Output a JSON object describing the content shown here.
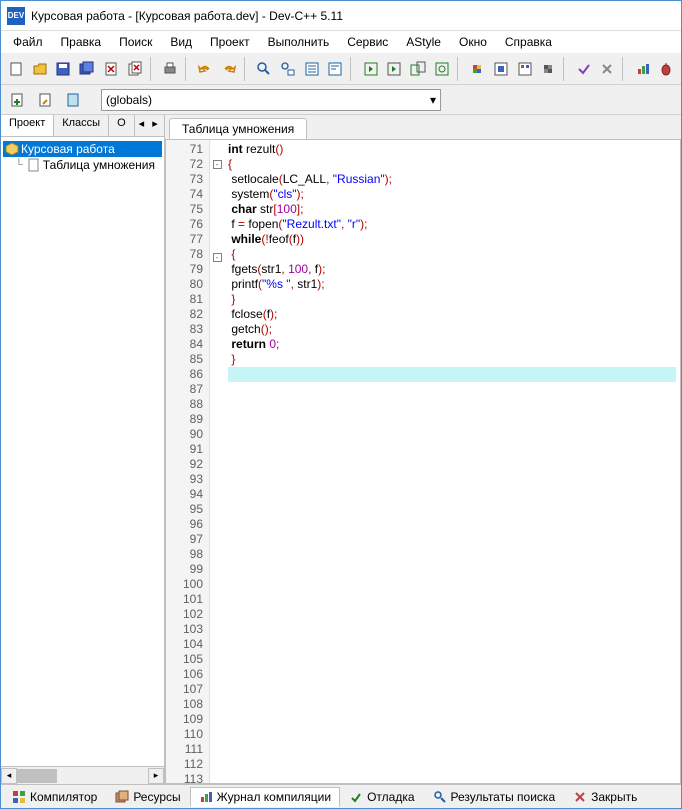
{
  "title": "Курсовая работа - [Курсовая работа.dev] - Dev-C++ 5.11",
  "menu": [
    "Файл",
    "Правка",
    "Поиск",
    "Вид",
    "Проект",
    "Выполнить",
    "Сервис",
    "AStyle",
    "Окно",
    "Справка"
  ],
  "globals": "(globals)",
  "left_tabs": {
    "project": "Проект",
    "classes": "Классы",
    "debug": "О"
  },
  "tree": {
    "root": "Курсовая работа",
    "child": "Таблица умножения"
  },
  "editor_tab": "Таблица умножения",
  "code_lines": [
    {
      "n": 71,
      "fold": "",
      "html": "<span class='kw'>int</span> <span class='fn'>rezult</span><span class='pun'>()</span>"
    },
    {
      "n": 72,
      "fold": "-",
      "html": "<span class='pun'>{</span>"
    },
    {
      "n": 73,
      "fold": "",
      "html": " <span class='fn'>setlocale</span><span class='pun'>(</span><span class='id'>LC_ALL</span><span class='pun'>,</span> <span class='str'>\"Russian\"</span><span class='pun'>);</span>"
    },
    {
      "n": 74,
      "fold": "",
      "html": " <span class='fn'>system</span><span class='pun'>(</span><span class='str'>\"cls\"</span><span class='pun'>);</span>"
    },
    {
      "n": 75,
      "fold": "",
      "html": " <span class='kw'>char</span> <span class='id'>str</span><span class='pun'>[</span><span class='num'>100</span><span class='pun'>];</span>"
    },
    {
      "n": 76,
      "fold": "",
      "html": " <span class='id'>f</span> <span class='pun'>=</span> <span class='fn'>fopen</span><span class='pun'>(</span><span class='str'>\"Rezult.txt\"</span><span class='pun'>,</span> <span class='str'>\"r\"</span><span class='pun'>);</span>"
    },
    {
      "n": 77,
      "fold": "",
      "html": " <span class='kw'>while</span><span class='pun'>(!</span><span class='fn'>feof</span><span class='pun'>(</span><span class='id'>f</span><span class='pun'>))</span>"
    },
    {
      "n": 78,
      "fold": "-",
      "html": " <span class='pun'>{</span>"
    },
    {
      "n": 79,
      "fold": "",
      "html": " <span class='fn'>fgets</span><span class='pun'>(</span><span class='id'>str1</span><span class='pun'>,</span> <span class='num'>100</span><span class='pun'>,</span> <span class='id'>f</span><span class='pun'>);</span>"
    },
    {
      "n": 80,
      "fold": "",
      "html": " <span class='fn'>printf</span><span class='pun'>(</span><span class='str'>\"%s \"</span><span class='pun'>,</span> <span class='id'>str1</span><span class='pun'>);</span>"
    },
    {
      "n": 81,
      "fold": "",
      "html": " <span class='pun'>}</span>"
    },
    {
      "n": 82,
      "fold": "",
      "html": " <span class='fn'>fclose</span><span class='pun'>(</span><span class='id'>f</span><span class='pun'>);</span>"
    },
    {
      "n": 83,
      "fold": "",
      "html": " <span class='fn'>getch</span><span class='pun'>();</span>"
    },
    {
      "n": 84,
      "fold": "",
      "html": " <span class='kw'>return</span> <span class='num'>0</span><span class='pun'>;</span>"
    },
    {
      "n": 85,
      "fold": "",
      "html": " <span class='pun'>}</span>"
    },
    {
      "n": 86,
      "fold": "",
      "html": "",
      "hl": true
    },
    {
      "n": 87,
      "fold": "",
      "html": ""
    },
    {
      "n": 88,
      "fold": "",
      "html": ""
    },
    {
      "n": 89,
      "fold": "",
      "html": ""
    },
    {
      "n": 90,
      "fold": "",
      "html": ""
    },
    {
      "n": 91,
      "fold": "",
      "html": ""
    },
    {
      "n": 92,
      "fold": "",
      "html": ""
    },
    {
      "n": 93,
      "fold": "",
      "html": ""
    },
    {
      "n": 94,
      "fold": "",
      "html": ""
    },
    {
      "n": 95,
      "fold": "",
      "html": ""
    },
    {
      "n": 96,
      "fold": "",
      "html": ""
    },
    {
      "n": 97,
      "fold": "",
      "html": ""
    },
    {
      "n": 98,
      "fold": "",
      "html": ""
    },
    {
      "n": 99,
      "fold": "",
      "html": ""
    },
    {
      "n": 100,
      "fold": "",
      "html": ""
    },
    {
      "n": 101,
      "fold": "",
      "html": ""
    },
    {
      "n": 102,
      "fold": "",
      "html": ""
    },
    {
      "n": 103,
      "fold": "",
      "html": ""
    },
    {
      "n": 104,
      "fold": "",
      "html": ""
    },
    {
      "n": 105,
      "fold": "",
      "html": ""
    },
    {
      "n": 106,
      "fold": "",
      "html": ""
    },
    {
      "n": 107,
      "fold": "",
      "html": ""
    },
    {
      "n": 108,
      "fold": "",
      "html": ""
    },
    {
      "n": 109,
      "fold": "",
      "html": ""
    },
    {
      "n": 110,
      "fold": "",
      "html": ""
    },
    {
      "n": 111,
      "fold": "",
      "html": ""
    },
    {
      "n": 112,
      "fold": "",
      "html": ""
    },
    {
      "n": 113,
      "fold": "",
      "html": ""
    }
  ],
  "bottom": {
    "compiler": "Компилятор",
    "resources": "Ресурсы",
    "log": "Журнал компиляции",
    "debug": "Отладка",
    "search": "Результаты поиска",
    "close": "Закрыть"
  }
}
